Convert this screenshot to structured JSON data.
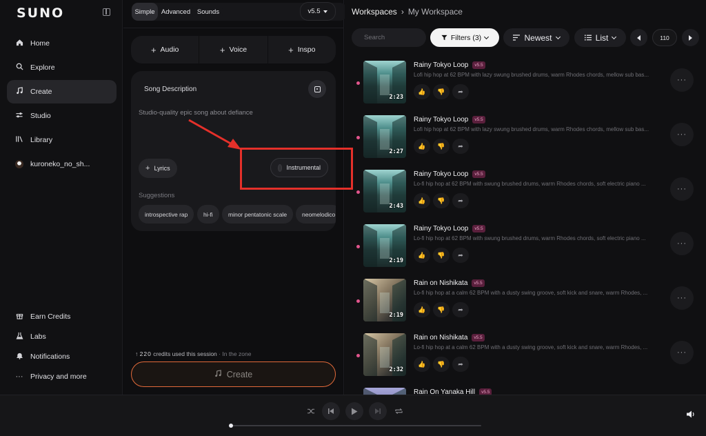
{
  "app": {
    "logo": "SUNO"
  },
  "sidebar": {
    "items": [
      {
        "label": "Home",
        "icon": "home-icon"
      },
      {
        "label": "Explore",
        "icon": "search-icon"
      },
      {
        "label": "Create",
        "icon": "music-note-icon",
        "active": true
      },
      {
        "label": "Studio",
        "icon": "sliders-icon"
      },
      {
        "label": "Library",
        "icon": "library-icon"
      },
      {
        "label": "kuroneko_no_sh...",
        "icon": "avatar"
      }
    ],
    "bottom": [
      {
        "label": "Earn Credits",
        "icon": "gift-icon"
      },
      {
        "label": "Labs",
        "icon": "flask-icon"
      },
      {
        "label": "Notifications",
        "icon": "bell-icon"
      },
      {
        "label": "Privacy and more",
        "icon": "ellipsis-icon"
      }
    ]
  },
  "create": {
    "tabs": [
      "Simple",
      "Advanced",
      "Sounds"
    ],
    "active_tab": "Simple",
    "version": "v5.5",
    "add_buttons": [
      "Audio",
      "Voice",
      "Inspo"
    ],
    "description_title": "Song Description",
    "description_text": "Studio-quality epic song about defiance",
    "lyrics_label": "Lyrics",
    "instrumental_label": "Instrumental",
    "suggestions_label": "Suggestions",
    "suggestions": [
      "introspective rap",
      "hi-fi",
      "minor pentatonic scale",
      "neomelodico"
    ],
    "credits_count": "220",
    "credits_text": "credits used this session",
    "credits_sub": "· In the zone",
    "create_label": "Create"
  },
  "workspace": {
    "crumb_root": "Workspaces",
    "crumb_current": "My Workspace",
    "search_placeholder": "Search",
    "filters_label": "Filters (3)",
    "sort_label": "Newest",
    "view_label": "List",
    "page": "110",
    "songs": [
      {
        "title": "Rainy Tokyo Loop",
        "badge": "v5.5",
        "prompt": "Lofi hip hop at 62 BPM with lazy swung brushed drums, warm Rhodes chords, mellow sub bas...",
        "duration": "2:23",
        "scene": "alley"
      },
      {
        "title": "Rainy Tokyo Loop",
        "badge": "v5.5",
        "prompt": "Lofi hip hop at 62 BPM with lazy swung brushed drums, warm Rhodes chords, mellow sub bas...",
        "duration": "2:27",
        "scene": "alley"
      },
      {
        "title": "Rainy Tokyo Loop",
        "badge": "v5.5",
        "prompt": "Lo-fi hip hop at 62 BPM with swung brushed drums, warm Rhodes chords, soft electric piano ...",
        "duration": "2:43",
        "scene": "alley"
      },
      {
        "title": "Rainy Tokyo Loop",
        "badge": "v5.5",
        "prompt": "Lo-fi hip hop at 62 BPM with swung brushed drums, warm Rhodes chords, soft electric piano ...",
        "duration": "2:19",
        "scene": "alley"
      },
      {
        "title": "Rain on Nishikata",
        "badge": "v5.5",
        "prompt": "Lo-fi hip hop at a calm 62 BPM with a dusty swing groove, soft kick and snare, warm Rhodes, ...",
        "duration": "2:19",
        "scene": "room"
      },
      {
        "title": "Rain on Nishikata",
        "badge": "v5.5",
        "prompt": "Lo-fi hip hop at a calm 62 BPM with a dusty swing groove, soft kick and snare, warm Rhodes, ...",
        "duration": "2:32",
        "scene": "room"
      },
      {
        "title": "Rain On Yanaka Hill",
        "badge": "v5.5",
        "prompt": "",
        "duration": "",
        "scene": "dusk"
      }
    ]
  },
  "colors": {
    "accent_orange": "#e36a3a",
    "dot_pink": "#e2558d",
    "annotation_red": "#e5302a"
  }
}
